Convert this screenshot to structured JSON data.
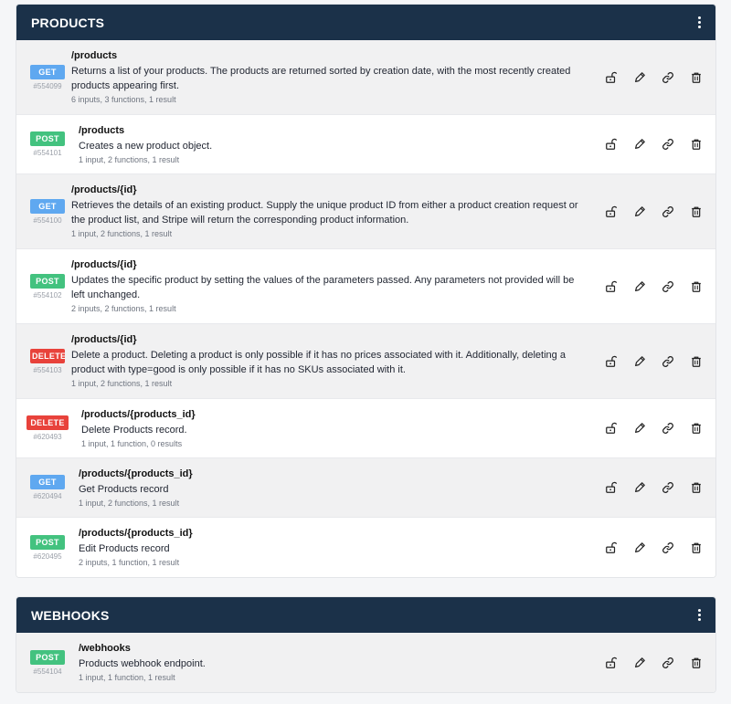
{
  "colors": {
    "header_bg": "#1b3149",
    "get": "#5fa8f0",
    "post": "#43c27f",
    "delete": "#e8423b"
  },
  "sections": [
    {
      "title": "PRODUCTS",
      "endpoints": [
        {
          "method": "GET",
          "id": "#554099",
          "path": "/products",
          "description": "Returns a list of your products. The products are returned sorted by creation date, with the most recently created products appearing first.",
          "meta": "6 inputs, 3 functions, 1 result"
        },
        {
          "method": "POST",
          "id": "#554101",
          "path": "/products",
          "description": "Creates a new product object.",
          "meta": "1 input, 2 functions, 1 result"
        },
        {
          "method": "GET",
          "id": "#554100",
          "path": "/products/{id}",
          "description": "Retrieves the details of an existing product. Supply the unique product ID from either a product creation request or the product list, and Stripe will return the corresponding product information.",
          "meta": "1 input, 2 functions, 1 result"
        },
        {
          "method": "POST",
          "id": "#554102",
          "path": "/products/{id}",
          "description": "Updates the specific product by setting the values of the parameters passed. Any parameters not provided will be left unchanged.",
          "meta": "2 inputs, 2 functions, 1 result"
        },
        {
          "method": "DELETE",
          "id": "#554103",
          "path": "/products/{id}",
          "description": "Delete a product. Deleting a product is only possible if it has no prices associated with it. Additionally, deleting a product with type=good is only possible if it has no SKUs associated with it.",
          "meta": "1 input, 2 functions, 1 result"
        },
        {
          "method": "DELETE",
          "id": "#620493",
          "path": "/products/{products_id}",
          "description": "Delete Products record.",
          "meta": "1 input, 1 function, 0 results"
        },
        {
          "method": "GET",
          "id": "#620494",
          "path": "/products/{products_id}",
          "description": "Get Products record",
          "meta": "1 input, 2 functions, 1 result"
        },
        {
          "method": "POST",
          "id": "#620495",
          "path": "/products/{products_id}",
          "description": "Edit Products record",
          "meta": "2 inputs, 1 function, 1 result"
        }
      ]
    },
    {
      "title": "WEBHOOKS",
      "endpoints": [
        {
          "method": "POST",
          "id": "#554104",
          "path": "/webhooks",
          "description": "Products webhook endpoint.",
          "meta": "1 input, 1 function, 1 result"
        }
      ]
    }
  ],
  "icons": [
    "lock-icon",
    "pencil-icon",
    "link-icon",
    "trash-icon"
  ]
}
